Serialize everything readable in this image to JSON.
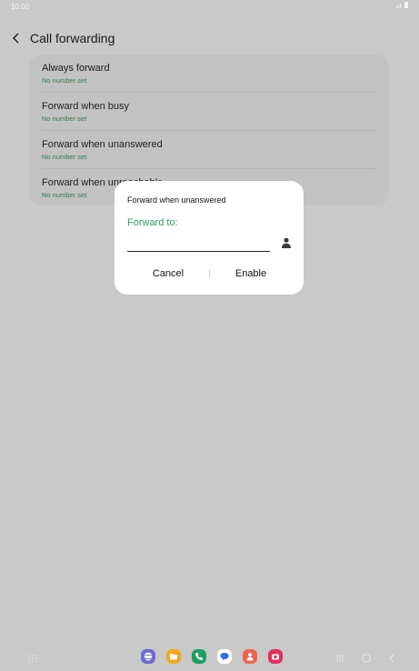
{
  "status_bar": {
    "time": "10:00"
  },
  "header": {
    "title": "Call forwarding"
  },
  "forwarding_options": [
    {
      "title": "Always forward",
      "subtitle": "No number set"
    },
    {
      "title": "Forward when busy",
      "subtitle": "No number set"
    },
    {
      "title": "Forward when unanswered",
      "subtitle": "No number set"
    },
    {
      "title": "Forward when unreachable",
      "subtitle": "No number set"
    }
  ],
  "dialog": {
    "title": "Forward when unanswered",
    "field_label": "Forward to:",
    "field_value": "",
    "cancel_label": "Cancel",
    "enable_label": "Enable"
  },
  "dock": {
    "apps": [
      {
        "name": "internet-app-icon",
        "color": "#6b6bd6"
      },
      {
        "name": "files-app-icon",
        "color": "#f2a81d"
      },
      {
        "name": "phone-app-icon",
        "color": "#1f9d63"
      },
      {
        "name": "messages-app-icon",
        "color": "#ffffff"
      },
      {
        "name": "contacts-app-icon",
        "color": "#f0614f"
      },
      {
        "name": "camera-app-icon",
        "color": "#e0305a"
      }
    ]
  },
  "colors": {
    "accent_green": "#2e9a5b",
    "subtitle_green": "#2e7d4f",
    "scrim": "#c9c9c9",
    "dialog_bg": "#ffffff"
  }
}
